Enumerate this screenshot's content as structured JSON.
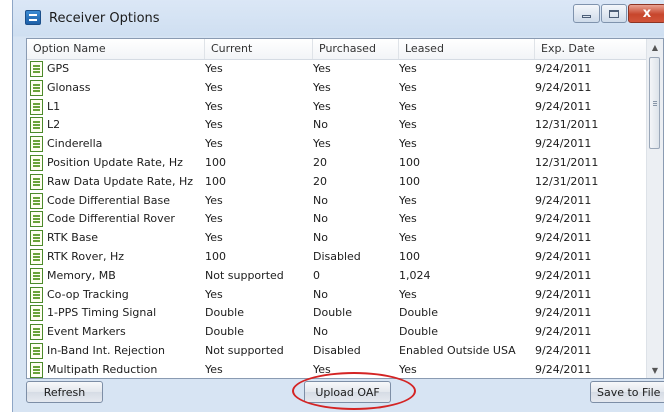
{
  "window": {
    "title": "Receiver Options",
    "minimize_label": "",
    "maximize_label": "",
    "close_label": "x"
  },
  "table": {
    "columns": [
      "Option Name",
      "Current",
      "Purchased",
      "Leased",
      "Exp. Date"
    ],
    "rows": [
      [
        "GPS",
        "Yes",
        "Yes",
        "Yes",
        "9/24/2011"
      ],
      [
        "Glonass",
        "Yes",
        "Yes",
        "Yes",
        "9/24/2011"
      ],
      [
        "L1",
        "Yes",
        "Yes",
        "Yes",
        "9/24/2011"
      ],
      [
        "L2",
        "Yes",
        "No",
        "Yes",
        "12/31/2011"
      ],
      [
        "Cinderella",
        "Yes",
        "Yes",
        "Yes",
        "9/24/2011"
      ],
      [
        "Position Update Rate, Hz",
        "100",
        "20",
        "100",
        "12/31/2011"
      ],
      [
        "Raw Data Update Rate, Hz",
        "100",
        "20",
        "100",
        "12/31/2011"
      ],
      [
        "Code Differential Base",
        "Yes",
        "No",
        "Yes",
        "9/24/2011"
      ],
      [
        "Code Differential Rover",
        "Yes",
        "No",
        "Yes",
        "9/24/2011"
      ],
      [
        "RTK Base",
        "Yes",
        "No",
        "Yes",
        "9/24/2011"
      ],
      [
        "RTK Rover, Hz",
        "100",
        "Disabled",
        "100",
        "9/24/2011"
      ],
      [
        "Memory, MB",
        "Not supported",
        "0",
        "1,024",
        "9/24/2011"
      ],
      [
        "Co-op Tracking",
        "Yes",
        "No",
        "Yes",
        "9/24/2011"
      ],
      [
        "1-PPS Timing Signal",
        "Double",
        "Double",
        "Double",
        "9/24/2011"
      ],
      [
        "Event Markers",
        "Double",
        "No",
        "Double",
        "9/24/2011"
      ],
      [
        "In-Band Int. Rejection",
        "Not supported",
        "Disabled",
        "Enabled Outside USA",
        "9/24/2011"
      ],
      [
        "Multipath Reduction",
        "Yes",
        "Yes",
        "Yes",
        "9/24/2011"
      ]
    ]
  },
  "buttons": {
    "refresh": "Refresh",
    "upload_oaf": "Upload OAF",
    "save_to_file": "Save to File"
  },
  "colors": {
    "highlight": "#d42424",
    "close_button": "#c7462c"
  },
  "icons": {
    "app": "receiver-options-app-icon",
    "row": "option-document-icon"
  }
}
